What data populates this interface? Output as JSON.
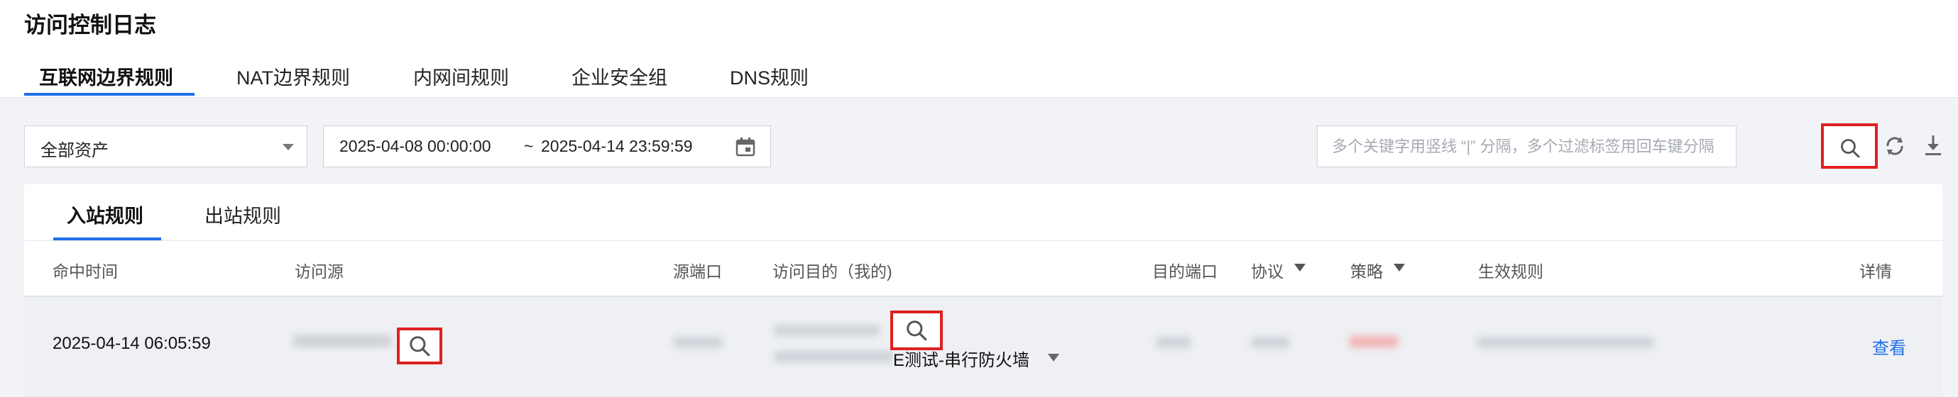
{
  "page": {
    "title": "访问控制日志"
  },
  "tabs": [
    {
      "label": "互联网边界规则",
      "active": true
    },
    {
      "label": "NAT边界规则",
      "active": false
    },
    {
      "label": "内网间规则",
      "active": false
    },
    {
      "label": "企业安全组",
      "active": false
    },
    {
      "label": "DNS规则",
      "active": false
    }
  ],
  "filters": {
    "asset_select": "全部资产",
    "date_start": "2025-04-08 00:00:00",
    "date_separator": "~",
    "date_end": "2025-04-14 23:59:59",
    "search_placeholder": "多个关键字用竖线 “|” 分隔，多个过滤标签用回车键分隔",
    "search_value": ""
  },
  "subtabs": [
    {
      "label": "入站规则",
      "active": true
    },
    {
      "label": "出站规则",
      "active": false
    }
  ],
  "table": {
    "columns": [
      "命中时间",
      "访问源",
      "源端口",
      "访问目的（我的)",
      "目的端口",
      "协议",
      "策略",
      "生效规则",
      "详情"
    ],
    "rows": [
      {
        "hit_time": "2025-04-14 06:05:59",
        "dest_label": "E测试-串行防火墙",
        "details": "查看"
      }
    ]
  },
  "colors": {
    "accent": "#1f6feb",
    "highlight_border": "#e02020",
    "page_bg": "#f2f3f7",
    "row_bg": "#eef0f4"
  },
  "icons": [
    "calendar-icon",
    "search-icon",
    "refresh-icon",
    "download-icon",
    "filter-icon",
    "chevron-down-icon"
  ]
}
